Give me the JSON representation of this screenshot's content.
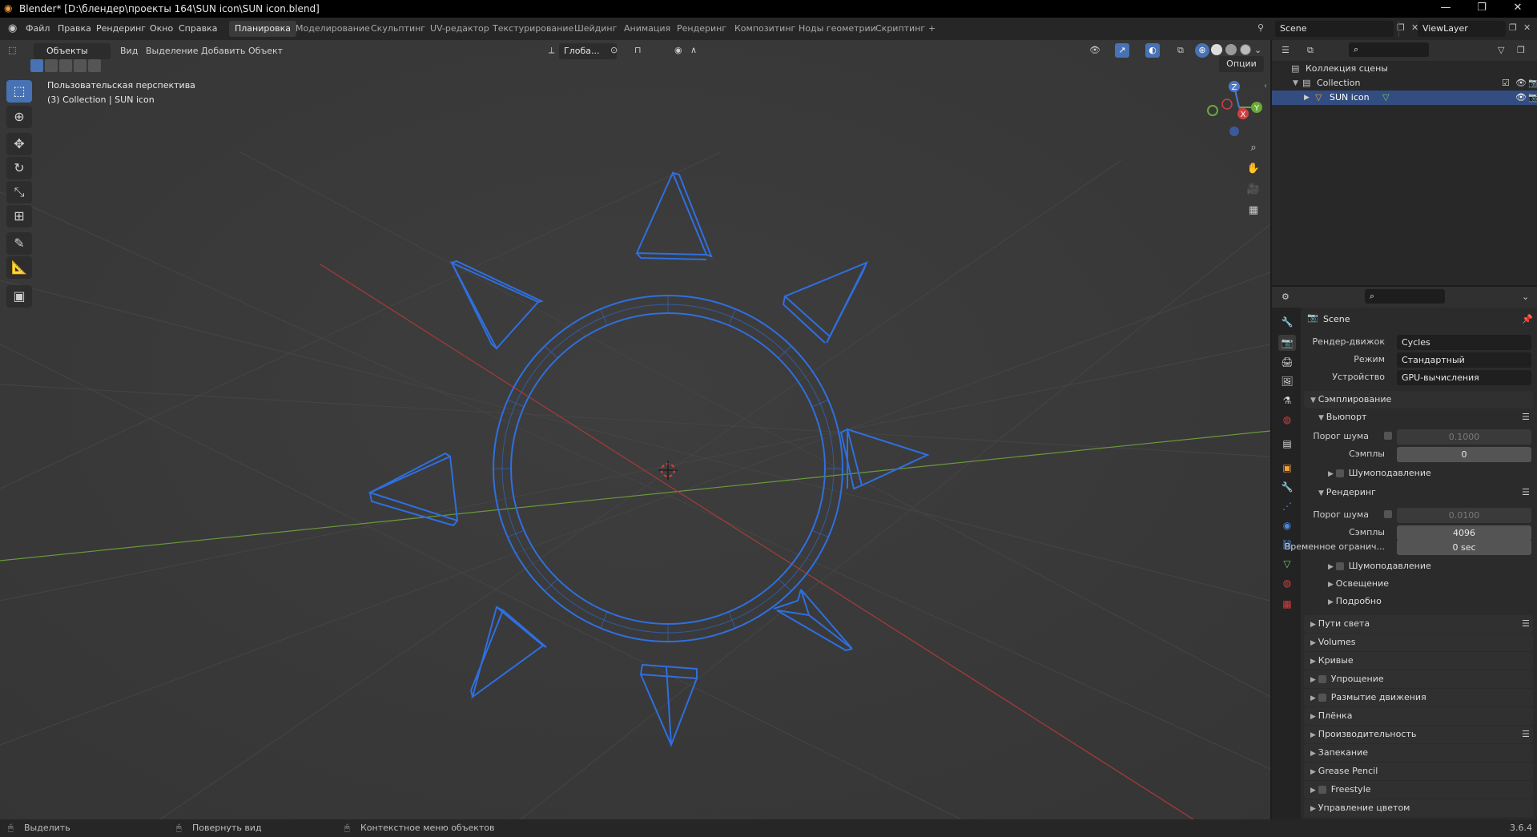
{
  "window": {
    "title": "Blender* [D:\\блендер\\проекты 164\\SUN icon\\SUN icon.blend]"
  },
  "menus": [
    "Файл",
    "Правка",
    "Рендеринг",
    "Окно",
    "Справка"
  ],
  "workspaces": [
    "Планировка",
    "Моделирование",
    "Скульптинг",
    "UV-редактор",
    "Текстурирование",
    "Шейдинг",
    "Анимация",
    "Рендеринг",
    "Композитинг",
    "Ноды геометрии",
    "Скриптинг"
  ],
  "active_workspace": "Планировка",
  "add_workspace": "+",
  "scene_field": "Scene",
  "viewlayer_field": "ViewLayer",
  "viewport": {
    "mode": "Объекты",
    "menus": [
      "Вид",
      "Выделение",
      "Добавить",
      "Объект"
    ],
    "transform_orientation": "Глоба...",
    "options_button": "Опции",
    "info_line1": "Пользовательская перспектива",
    "info_line2": "(3) Collection | SUN icon",
    "gizmo_axes": {
      "x": "X",
      "y": "Y",
      "z": "Z"
    },
    "wire_color": "#2f6fe0",
    "red_axis_color": "#a83a3a",
    "green_axis_color": "#6a9a3a"
  },
  "outliner": {
    "root": "Коллекция сцены",
    "collection": "Collection",
    "object": "SUN icon"
  },
  "properties": {
    "scene_name": "Scene",
    "render_engine_label": "Рендер-движок",
    "render_engine": "Cycles",
    "mode_label": "Режим",
    "mode": "Стандартный",
    "device_label": "Устройство",
    "device": "GPU-вычисления",
    "sampling": "Сэмплирование",
    "viewport_sub": "Вьюпорт",
    "noise_threshold_label": "Порог шума",
    "viewport_noise": "0.1000",
    "samples_label": "Сэмплы",
    "viewport_samples": "0",
    "denoise": "Шумоподавление",
    "render_sub": "Рендеринг",
    "render_noise": "0.0100",
    "render_samples": "4096",
    "time_limit_label": "Временное огранич...",
    "time_limit": "0 sec",
    "denoise2": "Шумоподавление",
    "lights": "Освещение",
    "advanced": "Подробно",
    "sections": [
      "Пути света",
      "Volumes",
      "Кривые",
      "Упрощение",
      "Размытие движения",
      "Плёнка",
      "Производительность",
      "Запекание",
      "Grease Pencil",
      "Freestyle",
      "Управление цветом"
    ]
  },
  "status": {
    "select": "Выделить",
    "rotate": "Повернуть вид",
    "context": "Контекстное меню объектов",
    "version": "3.6.4"
  }
}
